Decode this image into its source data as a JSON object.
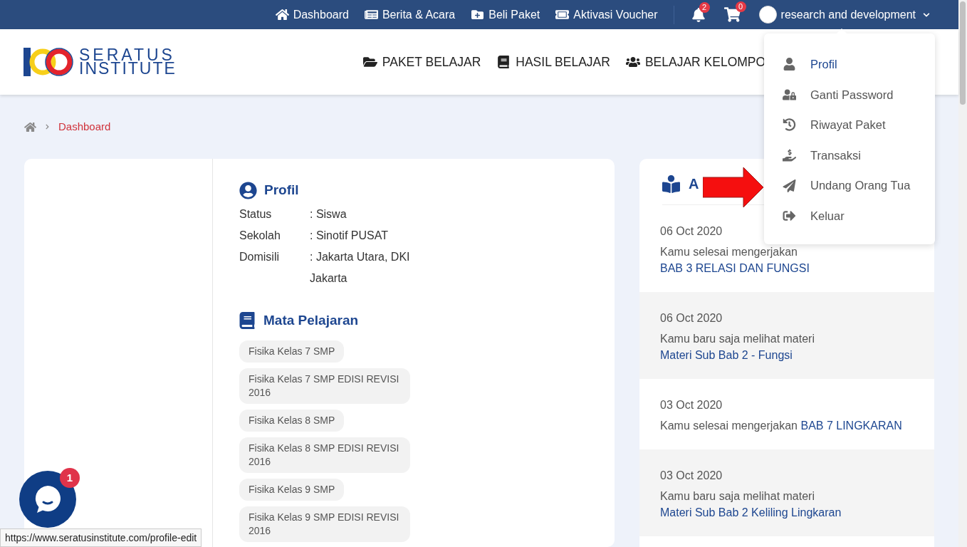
{
  "top_nav": {
    "links": [
      {
        "label": "Dashboard"
      },
      {
        "label": "Berita & Acara"
      },
      {
        "label": "Beli Paket"
      },
      {
        "label": "Aktivasi Voucher"
      }
    ],
    "notifications": {
      "count": "2"
    },
    "cart": {
      "count": "0"
    },
    "user": {
      "name": "research and development"
    }
  },
  "header": {
    "logo": [
      "SERATUS",
      "INSTITUTE"
    ],
    "menu": [
      {
        "label": "PAKET BELAJAR"
      },
      {
        "label": "HASIL BELAJAR"
      },
      {
        "label": "BELAJAR KELOMPO"
      }
    ]
  },
  "user_menu": [
    {
      "label": "Profil",
      "selected": true
    },
    {
      "label": "Ganti Password",
      "selected": false
    },
    {
      "label": "Riwayat Paket",
      "selected": false
    },
    {
      "label": "Transaksi",
      "selected": false
    },
    {
      "label": "Undang Orang Tua",
      "selected": false
    },
    {
      "label": "Keluar",
      "selected": false
    }
  ],
  "breadcrumb": {
    "current": "Dashboard"
  },
  "profile": {
    "title": "Profil",
    "fields": [
      {
        "label": "Status",
        "value": ": Siswa"
      },
      {
        "label": "Sekolah",
        "value": ": Sinotif PUSAT"
      },
      {
        "label": "Domisili",
        "value": ": Jakarta Utara, DKI Jakarta"
      }
    ]
  },
  "subjects": {
    "title": "Mata Pelajaran",
    "items": [
      "Fisika Kelas 7 SMP",
      "Fisika Kelas 7 SMP EDISI REVISI 2016",
      "Fisika Kelas 8 SMP",
      "Fisika Kelas 8 SMP EDISI REVISI 2016",
      "Fisika Kelas 9 SMP",
      "Fisika Kelas 9 SMP EDISI REVISI 2016"
    ]
  },
  "activity": {
    "title": "A",
    "items": [
      {
        "date": "06 Oct 2020",
        "text": "Kamu selesai mengerjakan",
        "link": "BAB 3 RELASI DAN FUNGSI"
      },
      {
        "date": "06 Oct 2020",
        "text": "Kamu baru saja melihat materi",
        "link": "Materi Sub Bab 2 - Fungsi"
      },
      {
        "date": "03 Oct 2020",
        "text": "Kamu selesai mengerjakan",
        "link": "BAB 7 LINGKARAN"
      },
      {
        "date": "03 Oct 2020",
        "text": "Kamu baru saja melihat materi",
        "link": "Materi Sub Bab 2 Keliling Lingkaran"
      }
    ]
  },
  "chat": {
    "badge": "1"
  },
  "status_url": "https://www.seratusinstitute.com/profile-edit"
}
